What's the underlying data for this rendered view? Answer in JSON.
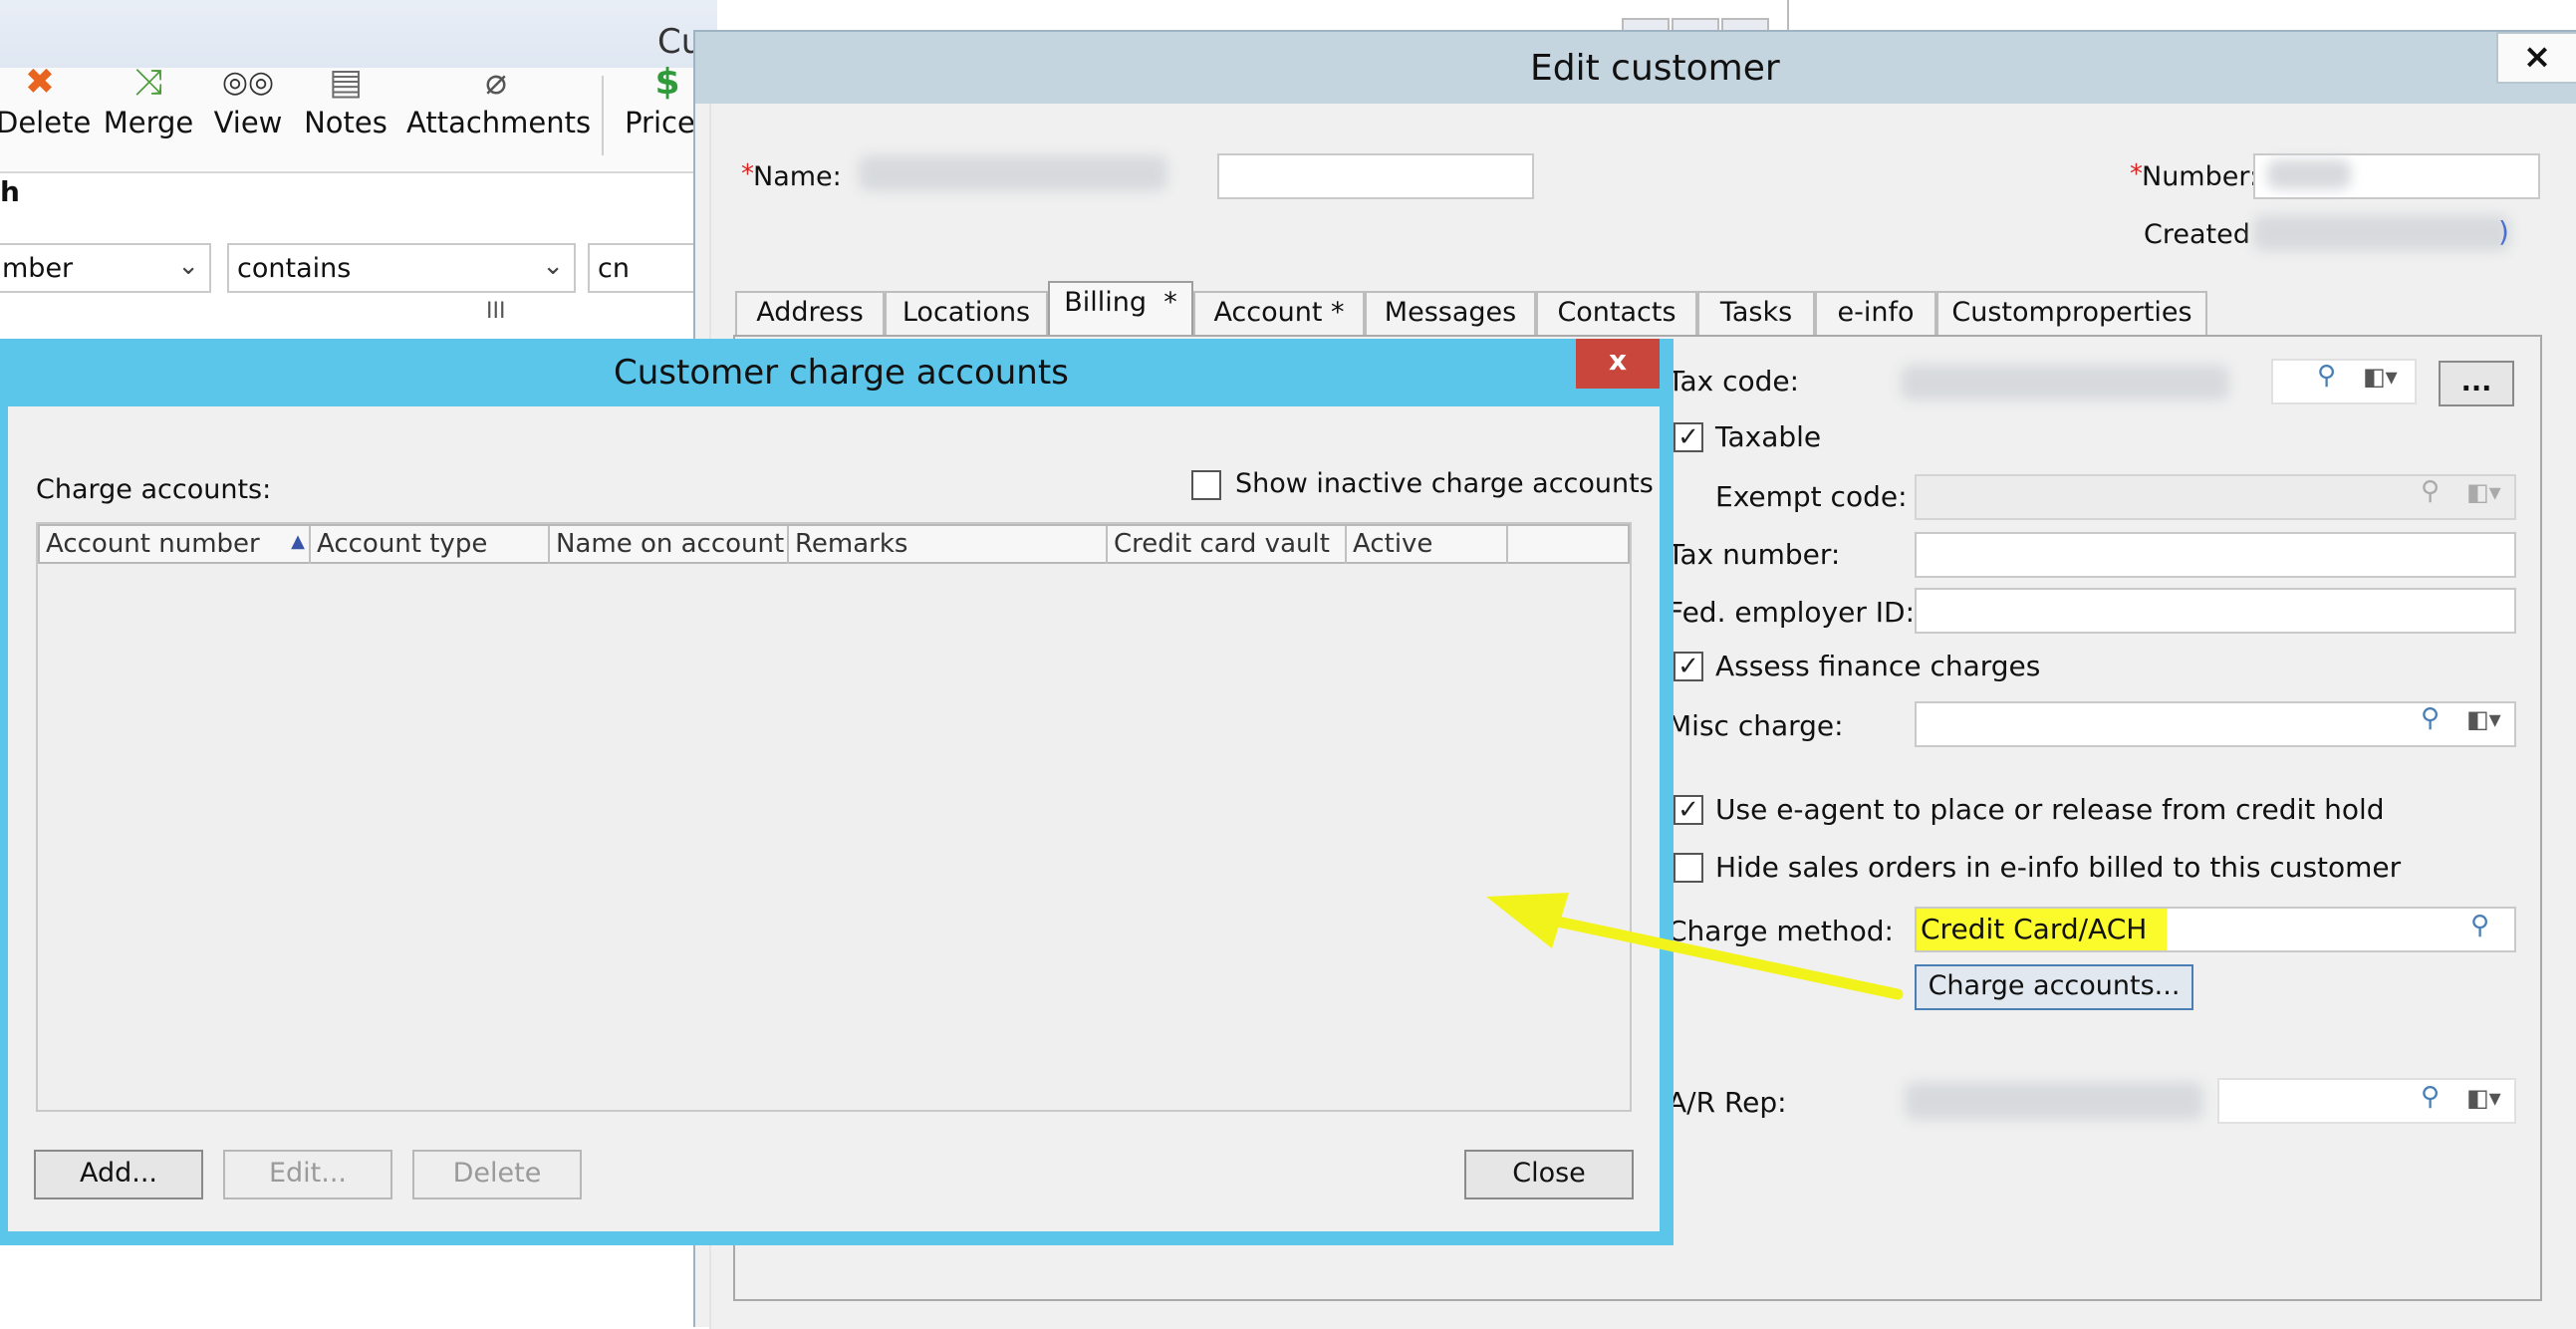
{
  "back_window": {
    "title_partial": "Cu",
    "toolbar": [
      {
        "label": "Delete",
        "icon": "delete-icon",
        "glyph": "✖",
        "color": "#e8641f"
      },
      {
        "label": "Merge",
        "icon": "merge-icon",
        "glyph": "⤨",
        "color": "#4c9a3a"
      },
      {
        "label": "View",
        "icon": "binoculars-icon",
        "glyph": "👓",
        "color": "#333333"
      },
      {
        "label": "Notes",
        "icon": "notes-icon",
        "glyph": "▤",
        "color": "#6b6b6b"
      },
      {
        "label": "Attachments",
        "icon": "paperclip-icon",
        "glyph": "⌀",
        "color": "#555555"
      },
      {
        "label": "Prices",
        "icon": "dollar-icon",
        "glyph": "$",
        "color": "#2f9a3a"
      }
    ],
    "search_heading": "h",
    "filter_field": "mber",
    "filter_operator": "contains",
    "filter_value": "cn",
    "splitter": "III"
  },
  "edit_customer": {
    "title": "Edit customer",
    "close": "×",
    "name_required": "*",
    "name_label": "Name:",
    "number_required": "*",
    "number_label": "Number:",
    "created_label": "Created",
    "tabs": [
      {
        "label": "Address",
        "active": false
      },
      {
        "label": "Locations",
        "active": false
      },
      {
        "label": "Billing  *",
        "active": true
      },
      {
        "label": "Account *",
        "active": false
      },
      {
        "label": "Messages",
        "active": false
      },
      {
        "label": "Contacts",
        "active": false
      },
      {
        "label": "Tasks",
        "active": false
      },
      {
        "label": "e-info",
        "active": false
      },
      {
        "label": "Customproperties",
        "active": false
      }
    ],
    "billing": {
      "tax_code_label": "Tax code:",
      "ellipsis_button": "...",
      "taxable_label": "Taxable",
      "taxable_checked": true,
      "exempt_code_label": "Exempt code:",
      "tax_number_label": "Tax number:",
      "fed_employer_label": "Fed. employer ID:",
      "assess_finance_label": "Assess finance charges",
      "assess_finance_checked": true,
      "misc_charge_label": "Misc charge:",
      "use_eagent_label": "Use e-agent to place or release from credit hold",
      "use_eagent_checked": true,
      "hide_sales_label": "Hide sales orders in e-info billed to this customer",
      "hide_sales_checked": false,
      "charge_method_label": "Charge method:",
      "charge_method_value": "Credit Card/ACH",
      "charge_accounts_button": "Charge accounts...",
      "ar_rep_label": "A/R Rep:"
    }
  },
  "charge_dialog": {
    "title": "Customer charge accounts",
    "close": "x",
    "charge_accounts_label": "Charge accounts:",
    "show_inactive_label": "Show inactive charge accounts",
    "show_inactive_checked": false,
    "columns": [
      "Account number",
      "Account type",
      "Name on account",
      "Remarks",
      "Credit card vault",
      "Active",
      ""
    ],
    "rows": [],
    "buttons": {
      "add": "Add...",
      "edit": "Edit...",
      "delete": "Delete",
      "close": "Close"
    }
  },
  "colors": {
    "dialog_border": "#5bc5ea",
    "close_red": "#c9463d",
    "highlight": "#fbfb2c",
    "arrow": "#f3f31c",
    "titlebar": "#c5d5df"
  }
}
